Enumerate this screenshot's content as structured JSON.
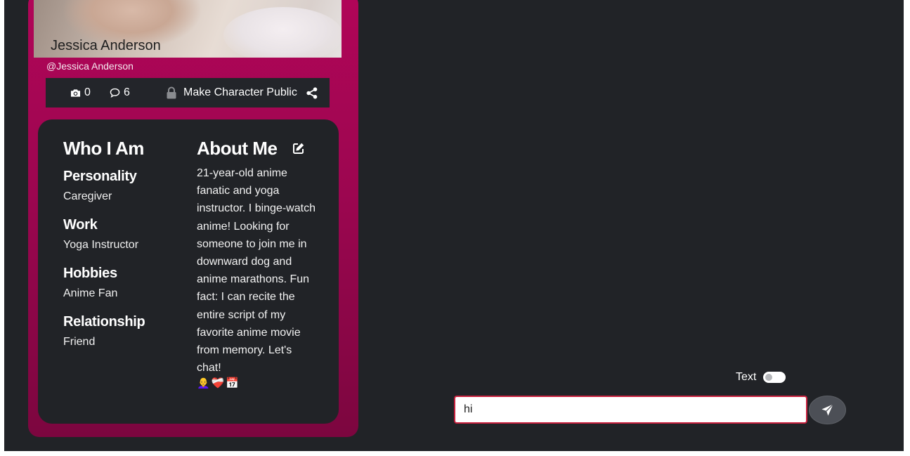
{
  "profile": {
    "photo_name": "Jessica Anderson",
    "handle": "@Jessica Anderson",
    "stats": {
      "photos_count": "0",
      "comments_count": "6",
      "public_label": "Make Character Public"
    },
    "who_i_am": {
      "heading": "Who I Am",
      "traits": [
        {
          "label": "Personality",
          "value": "Caregiver"
        },
        {
          "label": "Work",
          "value": "Yoga Instructor"
        },
        {
          "label": "Hobbies",
          "value": "Anime Fan"
        },
        {
          "label": "Relationship",
          "value": "Friend"
        }
      ]
    },
    "about_me": {
      "heading": "About Me",
      "bio": "21-year-old anime fanatic and yoga instructor. I binge-watch anime! Looking for someone to join me in downward dog and anime marathons. Fun fact: I can recite the entire script of my favorite anime movie from memory. Let's chat!",
      "emoji": "👩‍🦲❤️‍🩹📅"
    }
  },
  "composer": {
    "toggle_label": "Text",
    "toggle_on": false,
    "input_value": "hi"
  },
  "icons": {
    "photos": "camera-icon",
    "comments": "comment-icon",
    "public": "lock-icon",
    "share": "share-icon",
    "edit": "edit-icon",
    "send": "send-icon"
  },
  "colors": {
    "card_gradient_top": "#b10558",
    "card_gradient_bottom": "#7c063f",
    "panel_bg": "#212327",
    "input_border": "#c8203d",
    "send_button": "#4c4f56"
  }
}
